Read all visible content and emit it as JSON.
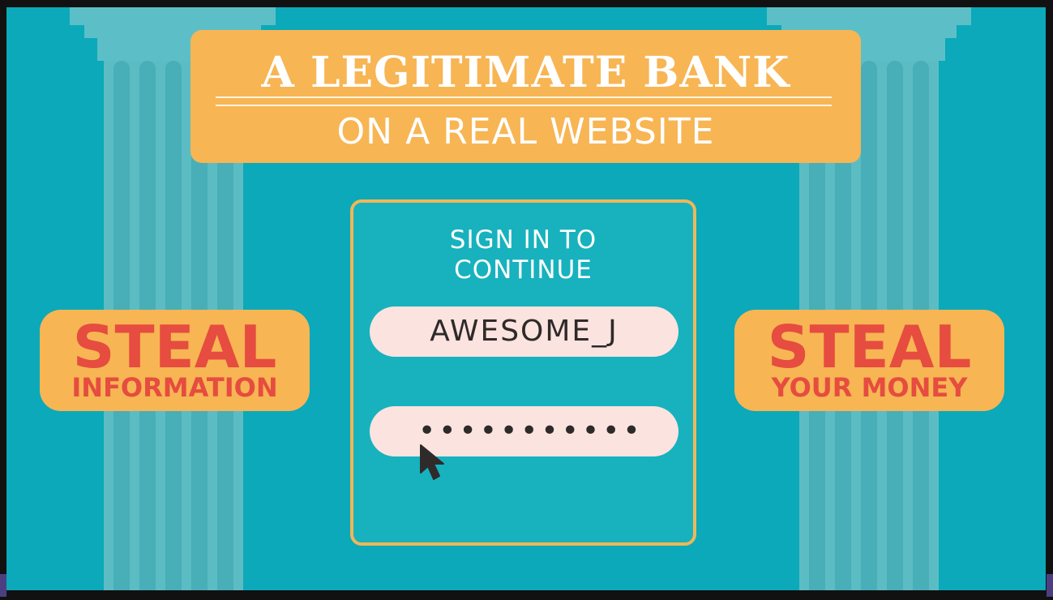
{
  "banner": {
    "title": "A LEGITIMATE BANK",
    "subtitle": "ON A REAL WEBSITE"
  },
  "left_badge": {
    "big": "STEAL",
    "small": "INFORMATION"
  },
  "right_badge": {
    "big": "STEAL",
    "small": "YOUR MONEY"
  },
  "login": {
    "heading_line1": "SIGN IN TO",
    "heading_line2": "CONTINUE",
    "username": "AWESOME_J",
    "password_mask": "•••••••••••"
  },
  "icons": {
    "cursor": "mouse-pointer-icon"
  },
  "colors": {
    "background": "#0ba9b9",
    "banner": "#f7b554",
    "badge_text": "#e64c3f",
    "field": "#fbe3df",
    "column": "#5cbcc4"
  }
}
